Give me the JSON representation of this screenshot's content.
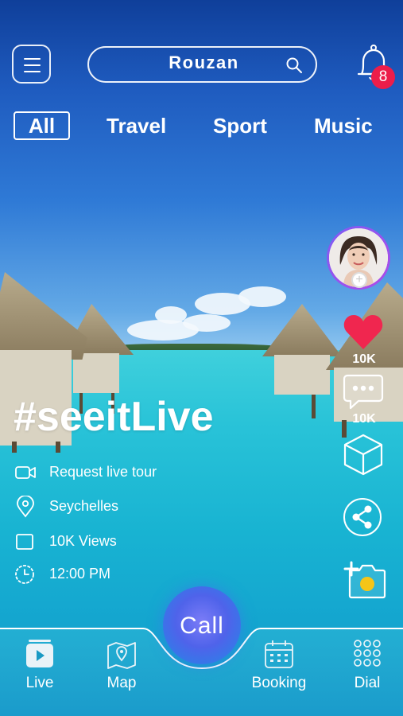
{
  "header": {
    "app_title": "Rouzan",
    "notification_count": "8"
  },
  "categories": [
    {
      "label": "All",
      "active": true
    },
    {
      "label": "Travel",
      "active": false
    },
    {
      "label": "Sport",
      "active": false
    },
    {
      "label": "Music",
      "active": false
    }
  ],
  "actions": {
    "likes_count": "10K",
    "comments_count": "10K"
  },
  "post": {
    "hashtag": "#seeitLive",
    "details": [
      {
        "icon": "video-camera-icon",
        "text": "Request live tour"
      },
      {
        "icon": "location-pin-icon",
        "text": "Seychelles"
      },
      {
        "icon": "screen-icon",
        "text": "10K Views"
      },
      {
        "icon": "clock-icon",
        "text": "12:00 PM"
      }
    ]
  },
  "bottom_nav": {
    "live": "Live",
    "map": "Map",
    "call": "Call",
    "booking": "Booking",
    "dial": "Dial"
  },
  "colors": {
    "badge": "#ec1d4a",
    "heart": "#f0264f",
    "camera_dot": "#f5c518",
    "call_gradient_center": "#7b7cf7"
  }
}
